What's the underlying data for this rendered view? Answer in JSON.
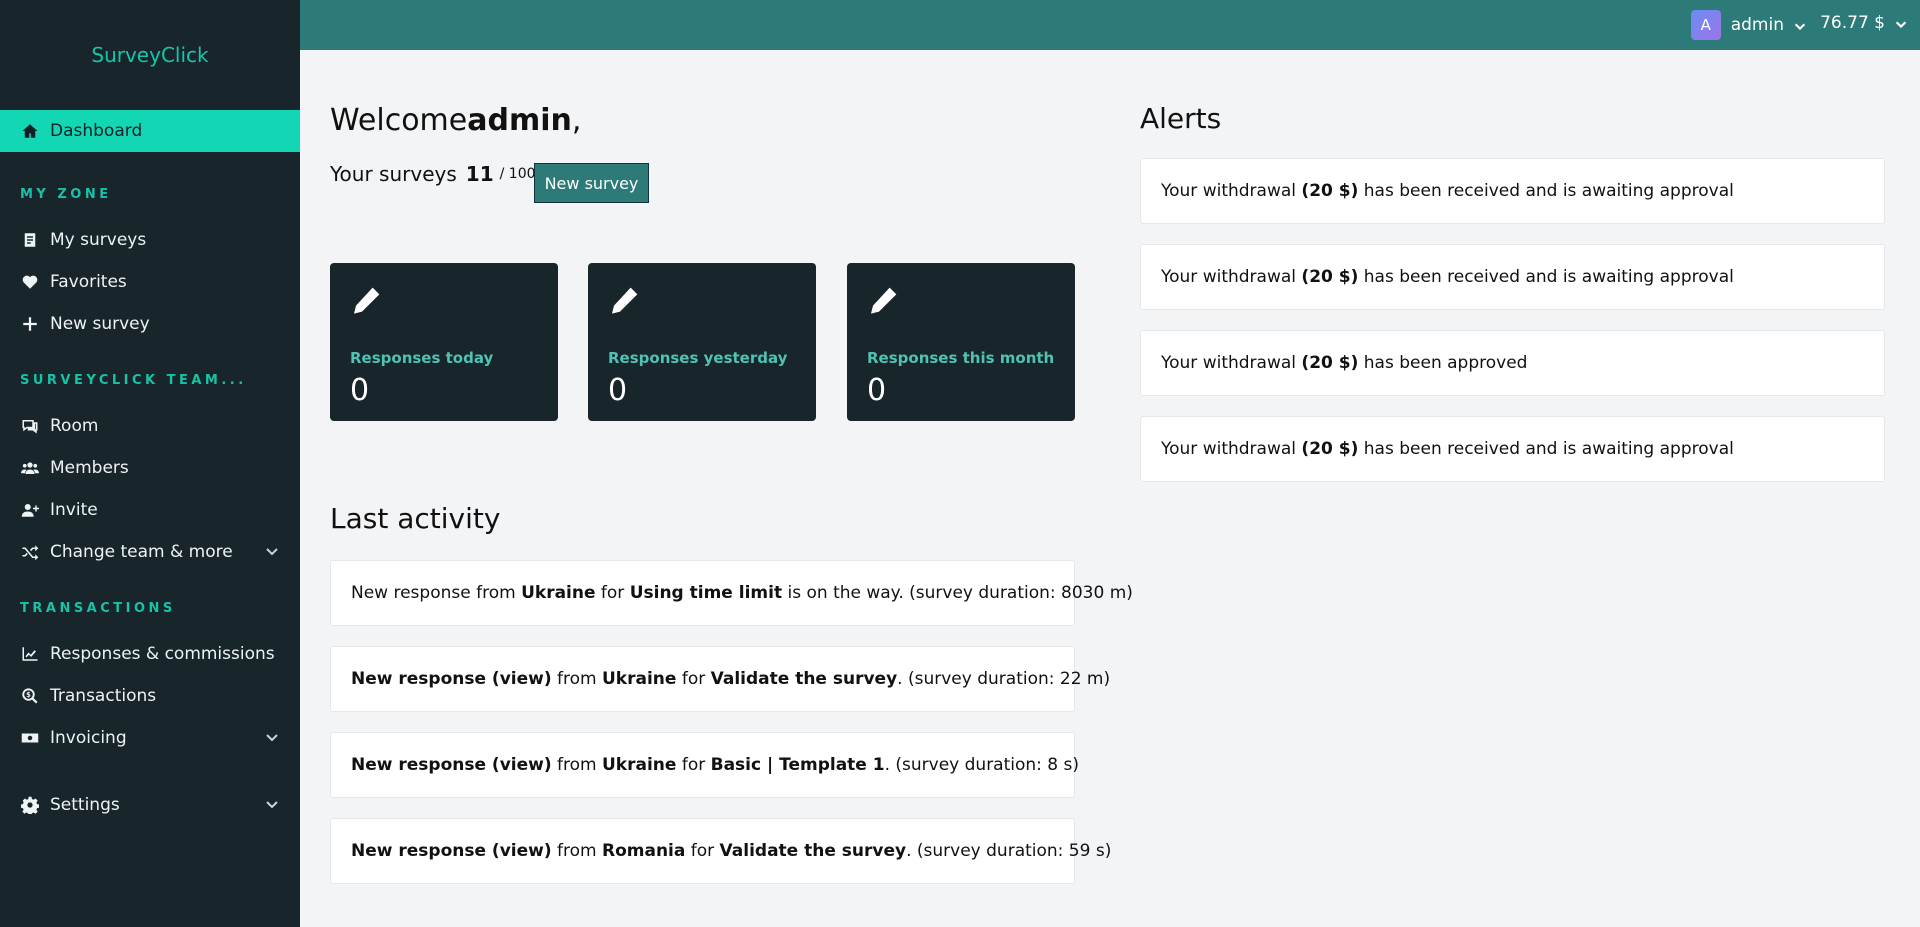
{
  "brand": "SurveyClick",
  "nav": {
    "dashboard": "Dashboard",
    "section_my_zone": "MY ZONE",
    "my_surveys": "My surveys",
    "favorites": "Favorites",
    "new_survey": "New survey",
    "section_team": "SURVEYCLICK TEAM...",
    "room": "Room",
    "members": "Members",
    "invite": "Invite",
    "change_team": "Change team & more",
    "section_transactions": "TRANSACTIONS",
    "responses_commissions": "Responses & commissions",
    "transactions": "Transactions",
    "invoicing": "Invoicing",
    "settings": "Settings"
  },
  "topbar": {
    "avatar_letter": "A",
    "username": "admin",
    "balance": "76.77 $"
  },
  "welcome": {
    "prefix": "Welcome ",
    "name": "admin",
    "suffix": ","
  },
  "surveys": {
    "label": "Your surveys",
    "count": "11",
    "max": "/ 100",
    "button": "New survey"
  },
  "stats": [
    {
      "label": "Responses today",
      "value": "0"
    },
    {
      "label": "Responses yesterday",
      "value": "0"
    },
    {
      "label": "Responses this month",
      "value": "0"
    }
  ],
  "last_activity": {
    "title": "Last activity",
    "items": [
      {
        "a": "New response from ",
        "b1": "Ukraine",
        "c": " for ",
        "b2": "Using time limit",
        "d": " is on the way. (survey duration: 8030 m)"
      },
      {
        "a0": "New response (view)",
        "a": " from ",
        "b1": "Ukraine",
        "c": " for ",
        "b2": "Validate the survey",
        "d": ". (survey duration: 22 m)"
      },
      {
        "a0": "New response (view)",
        "a": " from ",
        "b1": "Ukraine",
        "c": " for ",
        "b2": "Basic | Template 1",
        "d": ". (survey duration: 8 s)"
      },
      {
        "a0": "New response (view)",
        "a": " from ",
        "b1": "Romania",
        "c": " for ",
        "b2": "Validate the survey",
        "d": ". (survey duration: 59 s)"
      }
    ]
  },
  "alerts": {
    "title": "Alerts",
    "items": [
      {
        "a": "Your withdrawal ",
        "b": "(20 $)",
        "c": " has been received and is awaiting approval"
      },
      {
        "a": "Your withdrawal ",
        "b": "(20 $)",
        "c": " has been received and is awaiting approval"
      },
      {
        "a": "Your withdrawal ",
        "b": "(20 $)",
        "c": " has been approved"
      },
      {
        "a": "Your withdrawal ",
        "b": "(20 $)",
        "c": " has been received and is awaiting approval"
      }
    ]
  },
  "colors": {
    "sidebar": "#18252b",
    "accent": "#13d6b4",
    "topbar": "#2c7b78"
  }
}
